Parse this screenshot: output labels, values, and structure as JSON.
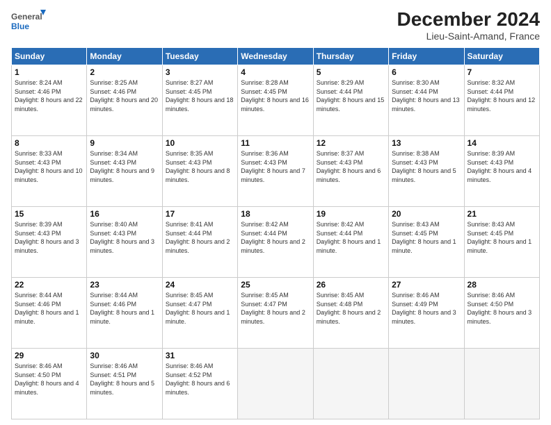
{
  "header": {
    "logo_general": "General",
    "logo_blue": "Blue",
    "title": "December 2024",
    "subtitle": "Lieu-Saint-Amand, France"
  },
  "columns": [
    "Sunday",
    "Monday",
    "Tuesday",
    "Wednesday",
    "Thursday",
    "Friday",
    "Saturday"
  ],
  "weeks": [
    [
      {
        "day": "1",
        "info": "Sunrise: 8:24 AM\nSunset: 4:46 PM\nDaylight: 8 hours and 22 minutes."
      },
      {
        "day": "2",
        "info": "Sunrise: 8:25 AM\nSunset: 4:46 PM\nDaylight: 8 hours and 20 minutes."
      },
      {
        "day": "3",
        "info": "Sunrise: 8:27 AM\nSunset: 4:45 PM\nDaylight: 8 hours and 18 minutes."
      },
      {
        "day": "4",
        "info": "Sunrise: 8:28 AM\nSunset: 4:45 PM\nDaylight: 8 hours and 16 minutes."
      },
      {
        "day": "5",
        "info": "Sunrise: 8:29 AM\nSunset: 4:44 PM\nDaylight: 8 hours and 15 minutes."
      },
      {
        "day": "6",
        "info": "Sunrise: 8:30 AM\nSunset: 4:44 PM\nDaylight: 8 hours and 13 minutes."
      },
      {
        "day": "7",
        "info": "Sunrise: 8:32 AM\nSunset: 4:44 PM\nDaylight: 8 hours and 12 minutes."
      }
    ],
    [
      {
        "day": "8",
        "info": "Sunrise: 8:33 AM\nSunset: 4:43 PM\nDaylight: 8 hours and 10 minutes."
      },
      {
        "day": "9",
        "info": "Sunrise: 8:34 AM\nSunset: 4:43 PM\nDaylight: 8 hours and 9 minutes."
      },
      {
        "day": "10",
        "info": "Sunrise: 8:35 AM\nSunset: 4:43 PM\nDaylight: 8 hours and 8 minutes."
      },
      {
        "day": "11",
        "info": "Sunrise: 8:36 AM\nSunset: 4:43 PM\nDaylight: 8 hours and 7 minutes."
      },
      {
        "day": "12",
        "info": "Sunrise: 8:37 AM\nSunset: 4:43 PM\nDaylight: 8 hours and 6 minutes."
      },
      {
        "day": "13",
        "info": "Sunrise: 8:38 AM\nSunset: 4:43 PM\nDaylight: 8 hours and 5 minutes."
      },
      {
        "day": "14",
        "info": "Sunrise: 8:39 AM\nSunset: 4:43 PM\nDaylight: 8 hours and 4 minutes."
      }
    ],
    [
      {
        "day": "15",
        "info": "Sunrise: 8:39 AM\nSunset: 4:43 PM\nDaylight: 8 hours and 3 minutes."
      },
      {
        "day": "16",
        "info": "Sunrise: 8:40 AM\nSunset: 4:43 PM\nDaylight: 8 hours and 3 minutes."
      },
      {
        "day": "17",
        "info": "Sunrise: 8:41 AM\nSunset: 4:44 PM\nDaylight: 8 hours and 2 minutes."
      },
      {
        "day": "18",
        "info": "Sunrise: 8:42 AM\nSunset: 4:44 PM\nDaylight: 8 hours and 2 minutes."
      },
      {
        "day": "19",
        "info": "Sunrise: 8:42 AM\nSunset: 4:44 PM\nDaylight: 8 hours and 1 minute."
      },
      {
        "day": "20",
        "info": "Sunrise: 8:43 AM\nSunset: 4:45 PM\nDaylight: 8 hours and 1 minute."
      },
      {
        "day": "21",
        "info": "Sunrise: 8:43 AM\nSunset: 4:45 PM\nDaylight: 8 hours and 1 minute."
      }
    ],
    [
      {
        "day": "22",
        "info": "Sunrise: 8:44 AM\nSunset: 4:46 PM\nDaylight: 8 hours and 1 minute."
      },
      {
        "day": "23",
        "info": "Sunrise: 8:44 AM\nSunset: 4:46 PM\nDaylight: 8 hours and 1 minute."
      },
      {
        "day": "24",
        "info": "Sunrise: 8:45 AM\nSunset: 4:47 PM\nDaylight: 8 hours and 1 minute."
      },
      {
        "day": "25",
        "info": "Sunrise: 8:45 AM\nSunset: 4:47 PM\nDaylight: 8 hours and 2 minutes."
      },
      {
        "day": "26",
        "info": "Sunrise: 8:45 AM\nSunset: 4:48 PM\nDaylight: 8 hours and 2 minutes."
      },
      {
        "day": "27",
        "info": "Sunrise: 8:46 AM\nSunset: 4:49 PM\nDaylight: 8 hours and 3 minutes."
      },
      {
        "day": "28",
        "info": "Sunrise: 8:46 AM\nSunset: 4:50 PM\nDaylight: 8 hours and 3 minutes."
      }
    ],
    [
      {
        "day": "29",
        "info": "Sunrise: 8:46 AM\nSunset: 4:50 PM\nDaylight: 8 hours and 4 minutes."
      },
      {
        "day": "30",
        "info": "Sunrise: 8:46 AM\nSunset: 4:51 PM\nDaylight: 8 hours and 5 minutes."
      },
      {
        "day": "31",
        "info": "Sunrise: 8:46 AM\nSunset: 4:52 PM\nDaylight: 8 hours and 6 minutes."
      },
      {
        "day": "",
        "info": ""
      },
      {
        "day": "",
        "info": ""
      },
      {
        "day": "",
        "info": ""
      },
      {
        "day": "",
        "info": ""
      }
    ]
  ]
}
